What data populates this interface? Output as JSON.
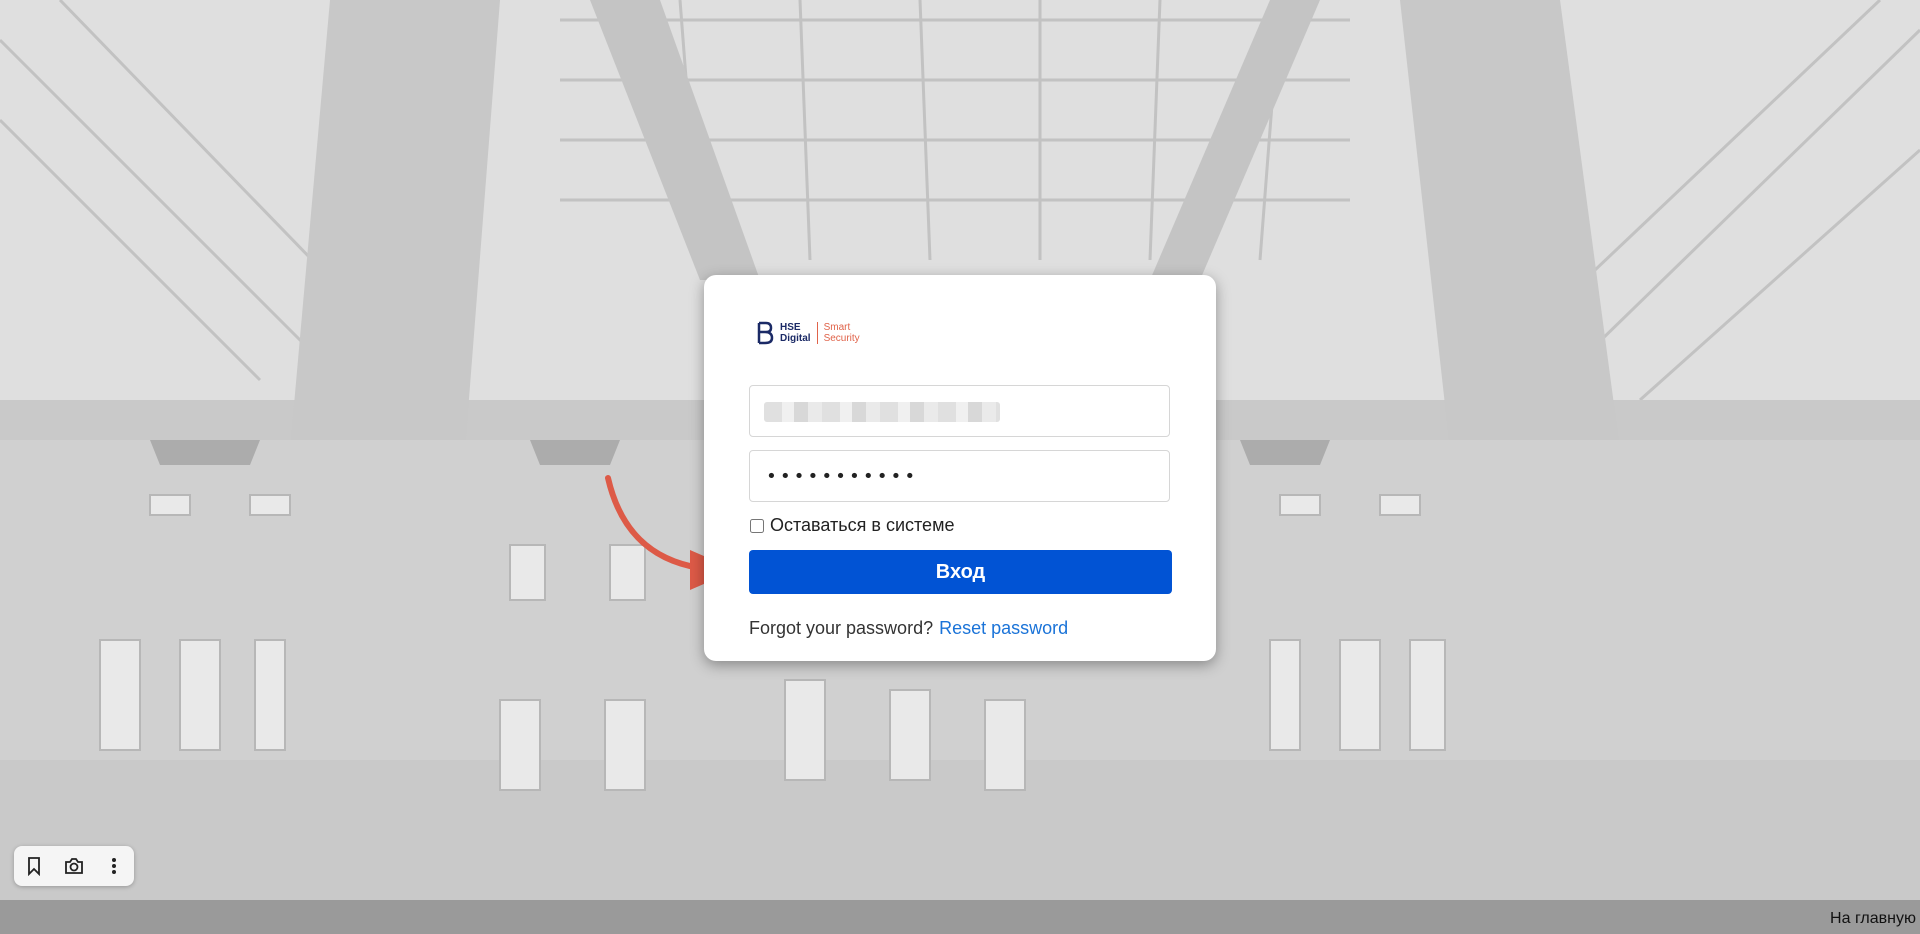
{
  "login": {
    "logo": {
      "brand_line1": "HSE",
      "brand_line2": "Digital",
      "product_line1": "Smart",
      "product_line2": "Security"
    },
    "username_value": "",
    "password_value": "•••••••••••",
    "remember_label": "Оставаться в системе",
    "submit_label": "Вход",
    "forgot_text": "Forgot your password?",
    "reset_link": "Reset password"
  },
  "footer": {
    "home_link": "На главную"
  },
  "toolbar": {
    "icons": [
      "bookmark-icon",
      "camera-icon",
      "more-vertical-icon"
    ]
  },
  "colors": {
    "primary_button": "#0153d4",
    "link": "#1a73d8",
    "arrow": "#dd5a47"
  }
}
